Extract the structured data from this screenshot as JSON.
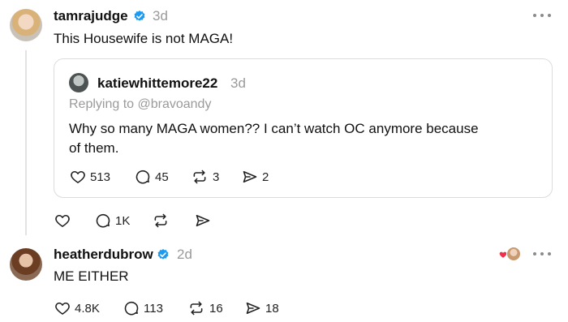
{
  "post1": {
    "username": "tamrajudge",
    "time": "3d",
    "text": "This Housewife is not MAGA!",
    "actions": {
      "likes": "",
      "comments": "1K",
      "reposts": "",
      "shares": ""
    }
  },
  "quote": {
    "username": "katiewhittemore22",
    "time": "3d",
    "replying_to": "Replying to @bravoandy",
    "text_line1": "Why so many MAGA women?? I can’t watch OC anymore because",
    "text_line2": "of them.",
    "actions": {
      "likes": "513",
      "comments": "45",
      "reposts": "3",
      "shares": "2"
    }
  },
  "post2": {
    "username": "heatherdubrow",
    "time": "2d",
    "text": "ME EITHER",
    "actions": {
      "likes": "4.8K",
      "comments": "113",
      "reposts": "16",
      "shares": "18"
    }
  },
  "colors": {
    "verified": "#1d9bf0",
    "heart": "#f0304a",
    "muted": "#9a9a9a"
  },
  "icons": [
    "verified-badge-icon",
    "heart-icon",
    "comment-icon",
    "repost-icon",
    "share-icon",
    "more-icon"
  ]
}
